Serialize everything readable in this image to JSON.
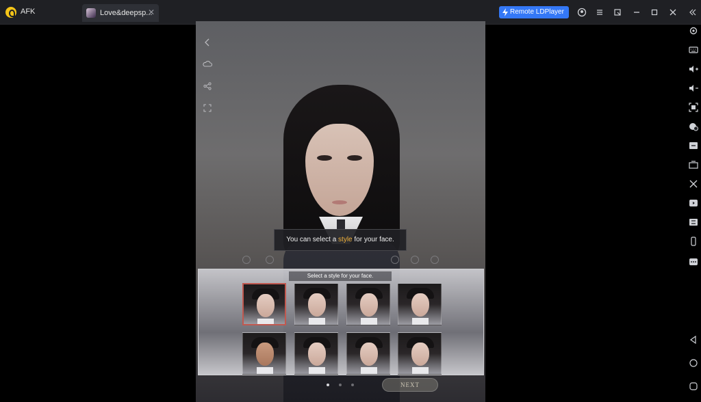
{
  "titlebar": {
    "app_name": "AFK",
    "tab_title": "Love&deepsp...",
    "tab_close": "✕",
    "remote_label": "Remote LDPlayer",
    "icons": [
      "account-icon",
      "menu-icon",
      "window-switch-icon",
      "minimize-icon",
      "maximize-icon",
      "close-icon",
      "collapse-sidebar-icon"
    ]
  },
  "game": {
    "side_icons": [
      "back-icon",
      "cloud-icon",
      "share-icon",
      "fullscreen-icon"
    ],
    "tip_prefix": "You can select a ",
    "tip_highlight": "style",
    "tip_suffix": " for your face.",
    "panel_title": "Select a style for your face.",
    "face_styles_count": 8,
    "selected_face_index": 0,
    "pager": {
      "total": 3,
      "active": 0
    },
    "next_label": "NEXT"
  },
  "sidebar": {
    "icons": [
      "settings-icon",
      "keyboard-icon",
      "volume-up-icon",
      "volume-down-icon",
      "screenshot-icon",
      "add-app-icon",
      "apk-icon",
      "fps-icon",
      "scissors-icon",
      "video-icon",
      "sync-icon",
      "phone-icon",
      "more-icon",
      "android-back-icon",
      "android-home-icon",
      "android-recent-icon"
    ]
  },
  "colors": {
    "accent_blue": "#3478f6",
    "highlight_orange": "#f0b13a",
    "selected_border": "#c0584f"
  }
}
